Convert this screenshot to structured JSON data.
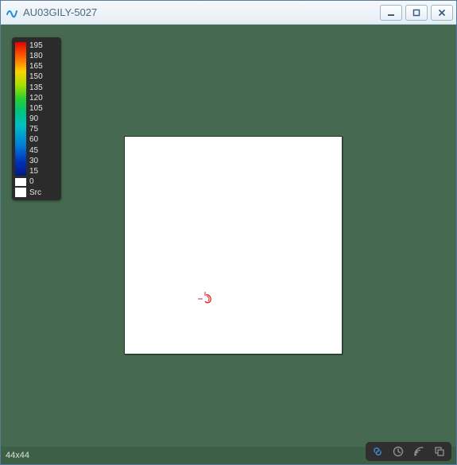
{
  "window": {
    "title": "AU03GILY-5027"
  },
  "legend": {
    "values": [
      "195",
      "180",
      "165",
      "150",
      "135",
      "120",
      "105",
      "90",
      "75",
      "60",
      "45",
      "30",
      "15"
    ],
    "zero_label": "0",
    "src_label": "Src"
  },
  "status": {
    "dimensions": "44x44"
  },
  "tray": {
    "link_icon": "link-icon",
    "clock_icon": "clock-icon",
    "satellite_icon": "satellite-icon",
    "copy_icon": "copy-icon"
  },
  "colors": {
    "content_bg": "#456a4f",
    "canvas_bg": "#ffffff",
    "legend_bg": "#2b2b2b",
    "link_active": "#3e8fd6"
  }
}
